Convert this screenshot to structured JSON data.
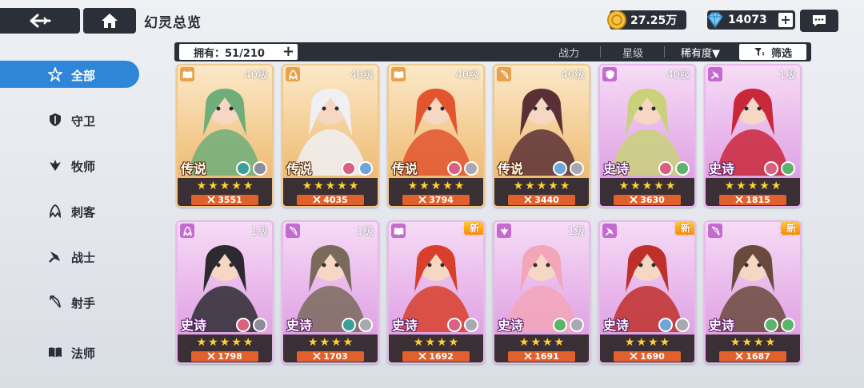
{
  "header": {
    "title": "幻灵总览",
    "gold": "27.25万",
    "gems": "14073",
    "plus": "+"
  },
  "filter": {
    "owned": "拥有：51/210",
    "sort_power": "战力",
    "sort_star": "星级",
    "sort_rarity": "稀有度▼",
    "filter_label": "筛选"
  },
  "sidebar": {
    "items": [
      {
        "label": "全部",
        "icon": "all-star-icon",
        "active": true
      },
      {
        "label": "守卫",
        "icon": "shield-icon"
      },
      {
        "label": "牧师",
        "icon": "priest-icon"
      },
      {
        "label": "刺客",
        "icon": "assassin-icon"
      },
      {
        "label": "战士",
        "icon": "sword-icon"
      },
      {
        "label": "射手",
        "icon": "bow-icon"
      },
      {
        "label": "法师",
        "icon": "book-icon"
      }
    ]
  },
  "cards": [
    {
      "rarity": "传说",
      "tier": "gold",
      "level": "40级",
      "stars": 5,
      "power": "3551",
      "class_icon": "book-icon",
      "elements": [
        "#3aa19a",
        "#8c8c9a"
      ],
      "new": false
    },
    {
      "rarity": "传说",
      "tier": "gold",
      "level": "40级",
      "stars": 5,
      "power": "4035",
      "class_icon": "assassin-icon",
      "elements": [
        "#d9607e",
        "#6ea6d8"
      ],
      "new": false
    },
    {
      "rarity": "传说",
      "tier": "gold",
      "level": "40级",
      "stars": 5,
      "power": "3794",
      "class_icon": "book-icon",
      "elements": [
        "#d9607e",
        "#a8a8b0"
      ],
      "new": false
    },
    {
      "rarity": "传说",
      "tier": "gold",
      "level": "40级",
      "stars": 5,
      "power": "3440",
      "class_icon": "bow-icon",
      "elements": [
        "#6ea6d8",
        "#a8a8b0"
      ],
      "new": false
    },
    {
      "rarity": "史诗",
      "tier": "purple",
      "level": "40级",
      "stars": 5,
      "power": "3630",
      "class_icon": "shield-icon",
      "elements": [
        "#d9607e",
        "#5ab56b"
      ],
      "new": false
    },
    {
      "rarity": "史诗",
      "tier": "purple",
      "level": "1级",
      "stars": 5,
      "power": "1815",
      "class_icon": "sword-icon",
      "elements": [
        "#d9607e",
        "#5ab56b"
      ],
      "new": false
    },
    {
      "rarity": "史诗",
      "tier": "purple",
      "level": "1级",
      "stars": 5,
      "power": "1798",
      "class_icon": "assassin-icon",
      "elements": [
        "#d9607e",
        "#8c8c9a"
      ],
      "new": false
    },
    {
      "rarity": "史诗",
      "tier": "purple",
      "level": "1级",
      "stars": 4,
      "power": "1703",
      "class_icon": "bow-icon",
      "elements": [
        "#3aa19a",
        "#a8a8b0"
      ],
      "new": false
    },
    {
      "rarity": "史诗",
      "tier": "purple",
      "level": "1级",
      "stars": 4,
      "power": "1692",
      "class_icon": "book-icon",
      "elements": [
        "#d9607e",
        "#a8a8b0"
      ],
      "new": true
    },
    {
      "rarity": "史诗",
      "tier": "purple",
      "level": "1级",
      "stars": 4,
      "power": "1691",
      "class_icon": "priest-icon",
      "elements": [
        "#5ab56b",
        "#a8a8b0"
      ],
      "new": false
    },
    {
      "rarity": "史诗",
      "tier": "purple",
      "level": "1级",
      "stars": 4,
      "power": "1690",
      "class_icon": "sword-icon",
      "elements": [
        "#6ea6d8",
        "#a8a8b0"
      ],
      "new": true
    },
    {
      "rarity": "史诗",
      "tier": "purple",
      "level": "1级",
      "stars": 4,
      "power": "1687",
      "class_icon": "bow-icon",
      "elements": [
        "#5ab56b",
        "#5ab56b"
      ],
      "new": true
    }
  ],
  "colors": {
    "accent": "#2f86d8",
    "dark": "#2b2f38",
    "power": "#e0612b",
    "star": "#ffd233"
  }
}
